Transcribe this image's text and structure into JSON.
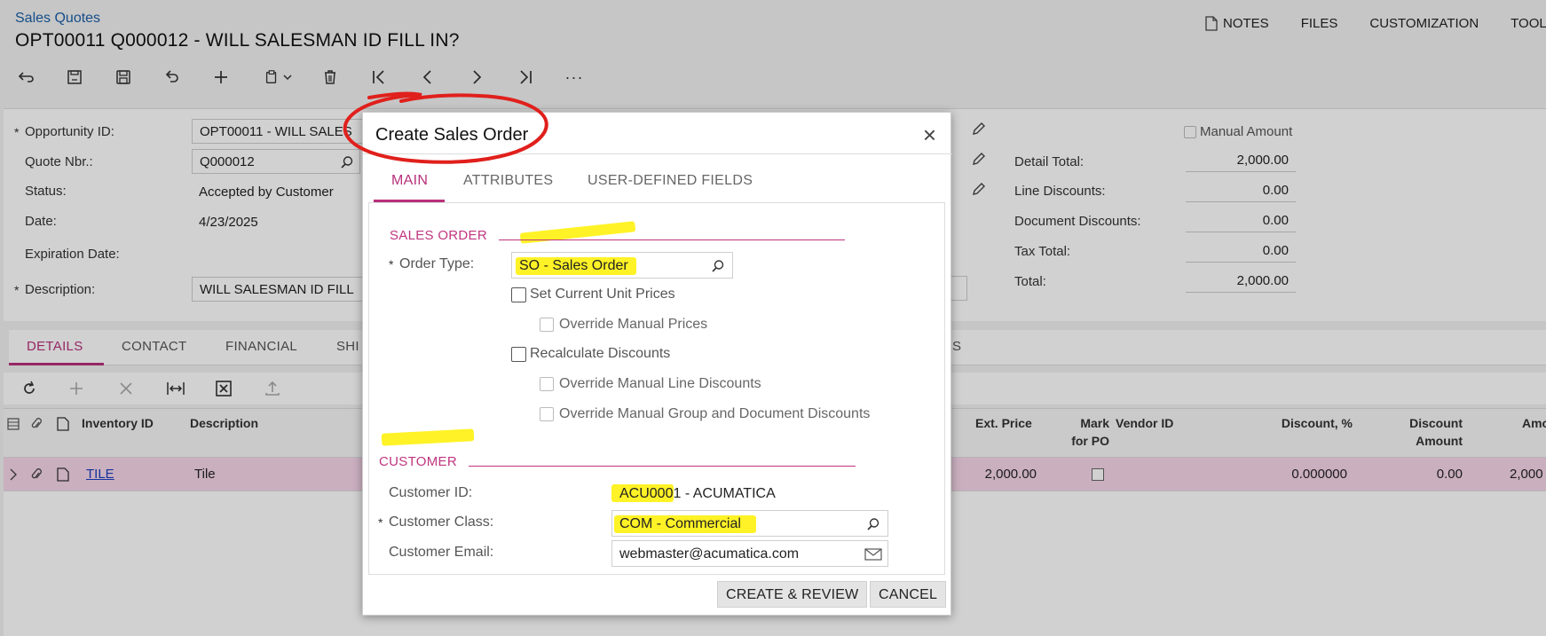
{
  "header": {
    "breadcrumb": "Sales Quotes",
    "title": "OPT00011 Q000012 - WILL SALESMAN ID FILL IN?",
    "nav": {
      "notes": "NOTES",
      "files": "FILES",
      "customization": "CUSTOMIZATION",
      "tools": "TOOL"
    }
  },
  "toolbar": {
    "icons": [
      "back-icon",
      "save-close-icon",
      "save-icon",
      "undo-icon",
      "add-icon",
      "clipboard-icon",
      "delete-icon",
      "first-icon",
      "prev-icon",
      "next-icon",
      "last-icon",
      "more-icon"
    ],
    "more": "···"
  },
  "form": {
    "opportunity_label": "Opportunity ID:",
    "opportunity_value": "OPT00011 - WILL SALES",
    "quote_label": "Quote Nbr.:",
    "quote_value": "Q000012",
    "status_label": "Status:",
    "status_value": "Accepted by Customer",
    "date_label": "Date:",
    "date_value": "4/23/2025",
    "expiration_label": "Expiration Date:",
    "description_label": "Description:",
    "description_value": "WILL SALESMAN ID FILL"
  },
  "summary": {
    "manual_amount": "Manual Amount",
    "detail_total_label": "Detail Total:",
    "detail_total": "2,000.00",
    "line_discounts_label": "Line Discounts:",
    "line_discounts": "0.00",
    "document_discounts_label": "Document Discounts:",
    "document_discounts": "0.00",
    "tax_total_label": "Tax Total:",
    "tax_total": "0.00",
    "total_label": "Total:",
    "total": "2,000.00"
  },
  "tabs": {
    "details": "DETAILS",
    "contact": "CONTACT",
    "financial": "FINANCIAL",
    "shipping": "SHI",
    "tail": "S"
  },
  "grid": {
    "headers": {
      "inventory_id": "Inventory ID",
      "description": "Description",
      "ext_price": "Ext. Price",
      "mark_for_po_1": "Mark",
      "mark_for_po_2": "for PO",
      "vendor_id": "Vendor ID",
      "discount_pct": "Discount, %",
      "discount_amount_1": "Discount",
      "discount_amount_2": "Amount",
      "amount": "Amo"
    },
    "row": {
      "inventory_id": "TILE",
      "description": "Tile",
      "ext_price": "2,000.00",
      "discount_pct": "0.000000",
      "discount_amount": "0.00",
      "amount": "2,000"
    }
  },
  "dialog": {
    "title": "Create Sales Order",
    "close": "×",
    "tabs": {
      "main": "MAIN",
      "attributes": "ATTRIBUTES",
      "udf": "USER-DEFINED FIELDS"
    },
    "sales_order_section": "SALES ORDER",
    "order_type_label": "Order Type:",
    "order_type_value": "SO - Sales Order",
    "set_current_unit_prices": "Set Current Unit Prices",
    "override_manual_prices": "Override Manual Prices",
    "recalculate_discounts": "Recalculate Discounts",
    "override_manual_line_discounts": "Override Manual Line Discounts",
    "override_manual_group_doc_discounts": "Override Manual Group and Document Discounts",
    "customer_section": "CUSTOMER",
    "customer_id_label": "Customer ID:",
    "customer_id_value": "ACU0001 - ACUMATICA",
    "customer_class_label": "Customer Class:",
    "customer_class_value": "COM - Commercial",
    "customer_email_label": "Customer Email:",
    "customer_email_value": "webmaster@acumatica.com",
    "create_review": "CREATE & REVIEW",
    "cancel": "CANCEL"
  },
  "colors": {
    "accent": "#b8307a",
    "highlight": "#fff000",
    "annotation": "#e0201c",
    "link": "#1a5fa8"
  }
}
